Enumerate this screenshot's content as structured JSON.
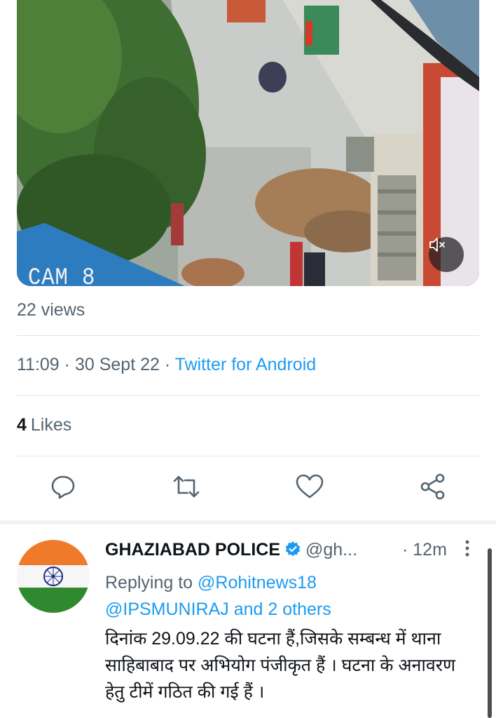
{
  "video": {
    "overlay_label": "CAM 8",
    "mute_icon": "speaker-muted-icon"
  },
  "stats": {
    "views": "22 views",
    "time": "11:09",
    "date": "30 Sept 22",
    "source": "Twitter for Android",
    "likes_count": "4",
    "likes_label": "Likes"
  },
  "actions": [
    {
      "name": "reply",
      "icon": "speech-bubble-icon"
    },
    {
      "name": "retweet",
      "icon": "retweet-arrows-icon"
    },
    {
      "name": "like",
      "icon": "heart-icon"
    },
    {
      "name": "share",
      "icon": "share-nodes-icon"
    }
  ],
  "reply": {
    "display_name": "GHAZIABAD POLICE",
    "handle": "@gh...",
    "time": "· 12m",
    "replying_prefix": "Replying to",
    "mention_1": "@Rohitnews18",
    "mention_2": "@IPSMUNIRAJ",
    "and_text": "and",
    "others": "2 others",
    "text": "दिनांक 29.09.22 की घटना हैं,जिसके सम्बन्ध में थाना साहिबाबाद पर अभियोग पंजीकृत हैं । घटना के अनावरण हेतु टीमें गठित की गई हैं ।"
  },
  "colors": {
    "link": "#1d9bf0",
    "muted": "#536471",
    "text": "#0f1419",
    "verified": "#1d9bf0"
  }
}
